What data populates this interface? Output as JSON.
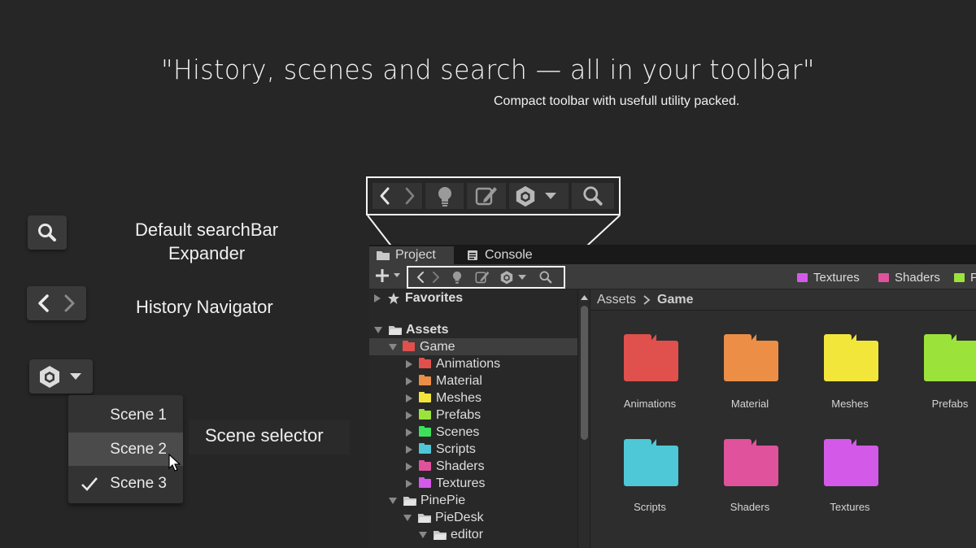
{
  "hero": {
    "title": "\"History, scenes and search — all in your toolbar\"",
    "subtitle": "Compact toolbar with usefull utility packed."
  },
  "features": {
    "search_label_1": "Default searchBar",
    "search_label_2": "Expander",
    "history_label": "History Navigator",
    "scene_label": "Scene selector"
  },
  "scene_menu": {
    "items": [
      "Scene 1",
      "Scene 2",
      "Scene 3"
    ],
    "checked": "Scene 3",
    "hovered": "Scene 2"
  },
  "editor": {
    "tabs": [
      "Project",
      "Console"
    ],
    "favorites_chips": [
      {
        "label": "Textures",
        "color": "#d35ae8"
      },
      {
        "label": "Shaders",
        "color": "#e0529c"
      },
      {
        "label": "P",
        "color": "#9be33a"
      }
    ],
    "tree": {
      "favorites": "Favorites",
      "assets": "Assets",
      "game": "Game",
      "children": [
        {
          "label": "Animations",
          "color": "#e0504c"
        },
        {
          "label": "Material",
          "color": "#ec8e45"
        },
        {
          "label": "Meshes",
          "color": "#f2e63a"
        },
        {
          "label": "Prefabs",
          "color": "#9be33a"
        },
        {
          "label": "Scenes",
          "color": "#3de05a"
        },
        {
          "label": "Scripts",
          "color": "#4ec8d6"
        },
        {
          "label": "Shaders",
          "color": "#e0529c"
        },
        {
          "label": "Textures",
          "color": "#d35ae8"
        }
      ],
      "pinepie": "PinePie",
      "piedesk": "PieDesk",
      "editor": "editor"
    },
    "breadcrumb": {
      "root": "Assets",
      "current": "Game"
    },
    "grid": [
      {
        "label": "Animations",
        "color": "#e0504c"
      },
      {
        "label": "Material",
        "color": "#ec8e45"
      },
      {
        "label": "Meshes",
        "color": "#f2e63a"
      },
      {
        "label": "Prefabs",
        "color": "#9be33a"
      },
      {
        "label": "Scripts",
        "color": "#4ec8d6"
      },
      {
        "label": "Shaders",
        "color": "#e0529c"
      },
      {
        "label": "Textures",
        "color": "#d35ae8"
      }
    ]
  }
}
